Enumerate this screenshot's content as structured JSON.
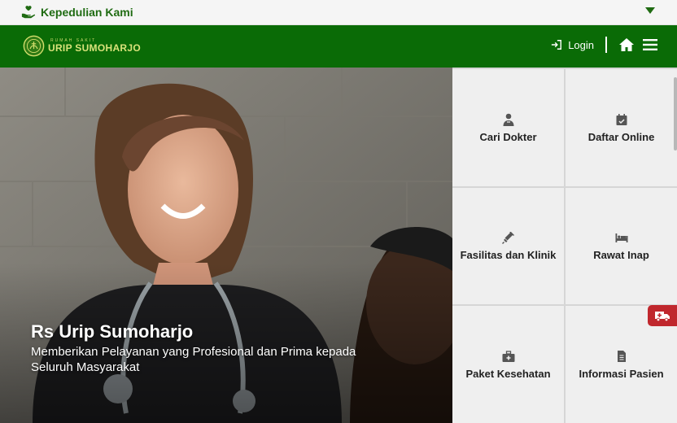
{
  "topbar": {
    "care_label": "Kepedulian Kami",
    "care_icon": "hand-heart-icon",
    "dropdown_icon": "chevron-down-icon"
  },
  "header": {
    "logo_small": "RUMAH SAKIT",
    "logo_big": "URIP SUMOHARJO",
    "login_label": "Login",
    "login_icon": "sign-in-icon",
    "home_icon": "home-icon",
    "menu_icon": "hamburger-menu-icon"
  },
  "hero": {
    "title": "Rs Urip Sumoharjo",
    "subtitle": "Memberikan Pelayanan yang Profesional dan Prima kepada Seluruh Masyarakat"
  },
  "menu_tiles": [
    {
      "label": "Cari Dokter",
      "icon": "doctor-icon"
    },
    {
      "label": "Daftar Online",
      "icon": "calendar-check-icon"
    },
    {
      "label": "Fasilitas dan Klinik",
      "icon": "syringe-icon"
    },
    {
      "label": "Rawat Inap",
      "icon": "bed-icon"
    },
    {
      "label": "Paket Kesehatan",
      "icon": "medkit-icon"
    },
    {
      "label": "Informasi Pasien",
      "icon": "document-icon"
    }
  ],
  "floating": {
    "ambulance_icon": "ambulance-icon"
  },
  "colors": {
    "brand_green": "#0a6b06",
    "care_green": "#1f6b12",
    "tile_bg": "#efefef",
    "emergency_red": "#c0272d"
  }
}
